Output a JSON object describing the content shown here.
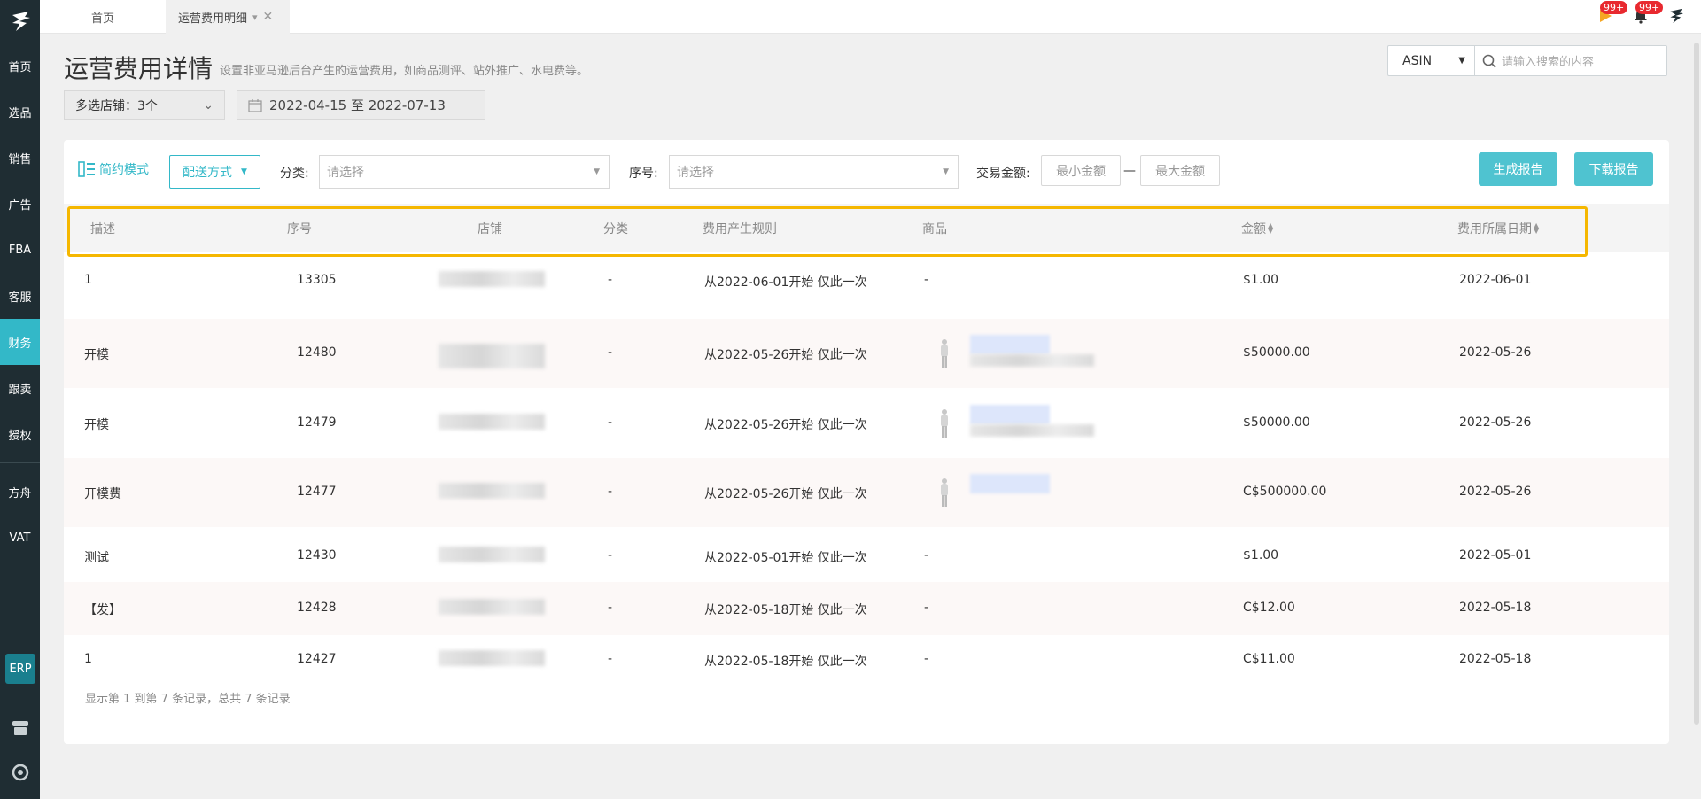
{
  "sidebar": {
    "items": [
      {
        "label": "首页"
      },
      {
        "label": "选品"
      },
      {
        "label": "销售"
      },
      {
        "label": "广告"
      },
      {
        "label": "FBA"
      },
      {
        "label": "客服"
      },
      {
        "label": "财务"
      },
      {
        "label": "跟卖"
      },
      {
        "label": "授权"
      },
      {
        "label": "方舟"
      },
      {
        "label": "VAT"
      }
    ],
    "active_index": 6,
    "erp_label": "ERP"
  },
  "tabs": {
    "home": "首页",
    "active": "运营费用明细"
  },
  "topbar": {
    "badge1": "99+",
    "badge2": "99+"
  },
  "header": {
    "title": "运营费用详情",
    "subtitle": "设置非亚马逊后台产生的运营费用，如商品测评、站外推广、水电费等。",
    "search_type": "ASIN",
    "search_placeholder": "请输入搜索的内容",
    "store_select": "多选店铺：3个",
    "date_range": "2022-04-15 至 2022-07-13"
  },
  "toolbar": {
    "mode_label": "简约模式",
    "delivery_label": "配送方式",
    "category_label": "分类:",
    "category_placeholder": "请选择",
    "serial_label": "序号:",
    "serial_placeholder": "请选择",
    "amount_label": "交易金额:",
    "min_amount": "最小金额",
    "dash": "—",
    "max_amount": "最大金额",
    "generate_report": "生成报告",
    "download_report": "下载报告"
  },
  "table": {
    "columns": [
      "描述",
      "序号",
      "店铺",
      "分类",
      "费用产生规则",
      "商品",
      "金额",
      "费用所属日期"
    ],
    "rows": [
      {
        "desc": "1",
        "serial": "13305",
        "category": "-",
        "rule": "从2022-06-01开始 仅此一次",
        "product": "-",
        "amount": "$1.00",
        "date": "2022-06-01"
      },
      {
        "desc": "开模",
        "serial": "12480",
        "category": "-",
        "rule": "从2022-05-26开始 仅此一次",
        "product": "",
        "amount": "$50000.00",
        "date": "2022-05-26"
      },
      {
        "desc": "开模",
        "serial": "12479",
        "category": "-",
        "rule": "从2022-05-26开始 仅此一次",
        "product": "",
        "amount": "$50000.00",
        "date": "2022-05-26"
      },
      {
        "desc": "开模费",
        "serial": "12477",
        "category": "-",
        "rule": "从2022-05-26开始 仅此一次",
        "product": "",
        "amount": "C$500000.00",
        "date": "2022-05-26"
      },
      {
        "desc": "测试",
        "serial": "12430",
        "category": "-",
        "rule": "从2022-05-01开始 仅此一次",
        "product": "-",
        "amount": "$1.00",
        "date": "2022-05-01"
      },
      {
        "desc": "【发】",
        "serial": "12428",
        "category": "-",
        "rule": "从2022-05-18开始 仅此一次",
        "product": "-",
        "amount": "C$12.00",
        "date": "2022-05-18"
      },
      {
        "desc": "1",
        "serial": "12427",
        "category": "-",
        "rule": "从2022-05-18开始 仅此一次",
        "product": "-",
        "amount": "C$11.00",
        "date": "2022-05-18"
      }
    ],
    "footer": "显示第 1 到第 7 条记录，总共 7 条记录"
  },
  "colors": {
    "sidebar_bg": "#1f2d33",
    "accent": "#33b8c8",
    "highlight": "#f5b700"
  }
}
